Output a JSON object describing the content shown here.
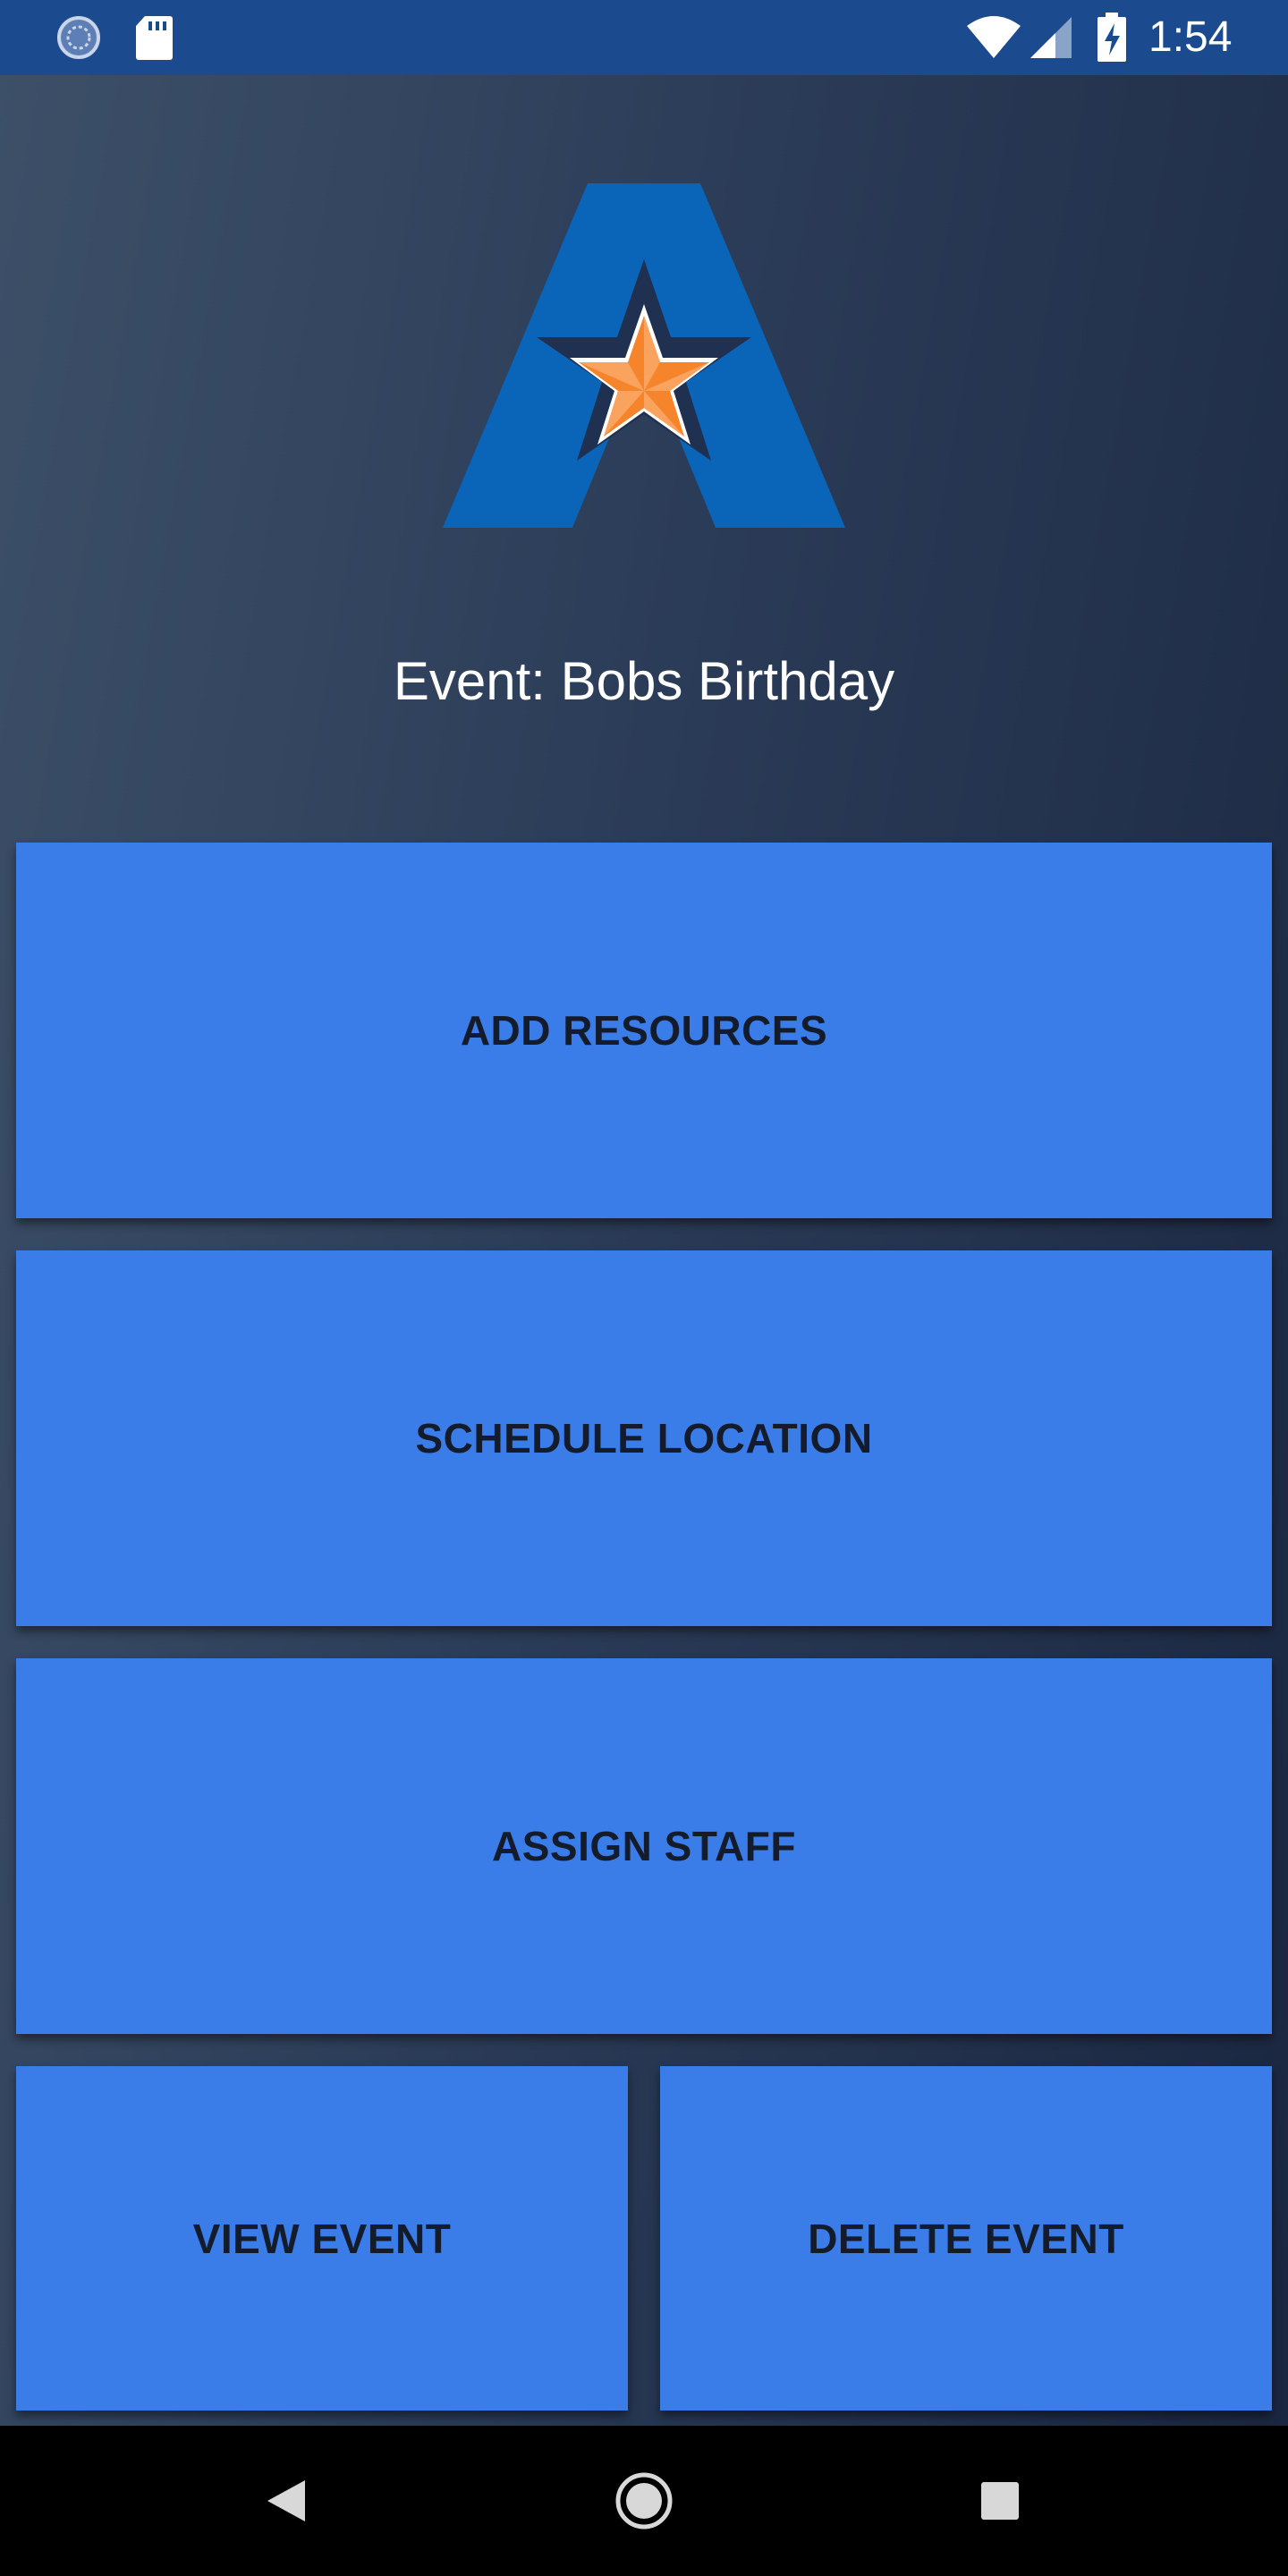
{
  "status_bar": {
    "time": "1:54",
    "icons": [
      "sync-icon",
      "sd-card-icon",
      "wifi-icon",
      "signal-icon",
      "battery-charging-icon"
    ]
  },
  "logo": {
    "icon": "uta-logo-icon",
    "colors": {
      "letter": "#0a64b8",
      "star_fill": "#f5842b",
      "star_outline": "#ffffff"
    }
  },
  "event": {
    "title": "Event: Bobs Birthday"
  },
  "buttons": {
    "add_resources": "ADD RESOURCES",
    "schedule_location": "SCHEDULE LOCATION",
    "assign_staff": "ASSIGN STAFF",
    "view_event": "VIEW EVENT",
    "delete_event": "DELETE EVENT"
  },
  "nav_bar": {
    "items": [
      "back-icon",
      "home-icon",
      "recents-icon"
    ]
  },
  "colors": {
    "status_bar": "#1c4a8f",
    "button": "#3b7de8",
    "button_text": "#141c2c",
    "nav_bar": "#000000"
  }
}
